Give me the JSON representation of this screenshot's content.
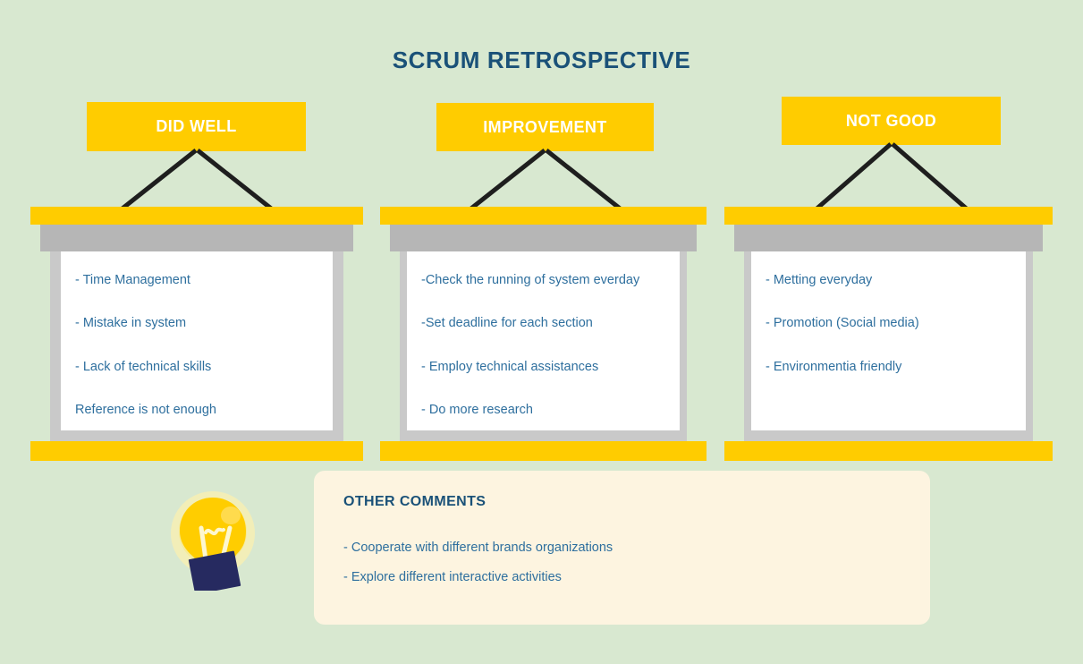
{
  "title": "SCRUM RETROSPECTIVE",
  "colors": {
    "background": "#d8e8d0",
    "accent_yellow": "#ffcc00",
    "title_blue": "#1a5178",
    "body_blue": "#2e6f9e",
    "panel_cream": "#fdf4e0",
    "frame_gray": "#c9c9c9",
    "shelf_gray": "#b6b6b6",
    "bulb_base_navy": "#262a60"
  },
  "columns": [
    {
      "banner_label": "DID WELL",
      "items": [
        "- Time Management",
        "- Mistake in system",
        "- Lack of technical skills",
        "Reference is not enough"
      ]
    },
    {
      "banner_label": "IMPROVEMENT",
      "items": [
        "-Check the running of system everday",
        "-Set deadline for each section",
        "- Employ technical assistances",
        "- Do more research"
      ]
    },
    {
      "banner_label": "NOT GOOD",
      "items": [
        "- Metting everyday",
        "- Promotion (Social media)",
        "- Environmentia friendly"
      ]
    }
  ],
  "comments": {
    "title": "OTHER COMMENTS",
    "items": [
      "- Cooperate with different brands organizations",
      "- Explore different interactive activities"
    ]
  },
  "icons": {
    "lightbulb": "lightbulb-icon"
  }
}
